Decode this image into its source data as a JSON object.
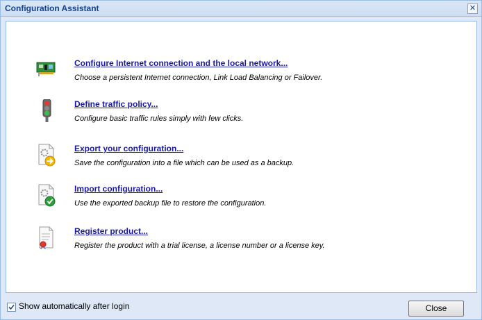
{
  "window": {
    "title": "Configuration Assistant",
    "close_glyph": "✕"
  },
  "items": [
    {
      "icon": "network-card-icon",
      "link": "Configure Internet connection and the local network...",
      "desc": "Choose a persistent Internet connection, Link Load Balancing or Failover."
    },
    {
      "icon": "traffic-light-icon",
      "link": "Define traffic policy...",
      "desc": "Configure basic traffic rules simply with few clicks."
    },
    {
      "icon": "export-config-icon",
      "link": "Export your configuration...",
      "desc": "Save the configuration into a file which can be used as a backup."
    },
    {
      "icon": "import-config-icon",
      "link": "Import configuration...",
      "desc": "Use the exported backup file to restore the configuration."
    },
    {
      "icon": "register-product-icon",
      "link": "Register product...",
      "desc": "Register the product with a trial license, a license number or a license key."
    }
  ],
  "footer": {
    "checkbox_label": "Show automatically after login",
    "checkbox_checked": true,
    "close_button": "Close"
  },
  "colors": {
    "link": "#1a1aa6",
    "title": "#15428b",
    "frame": "#dfe8f6",
    "border": "#99bbe8"
  }
}
